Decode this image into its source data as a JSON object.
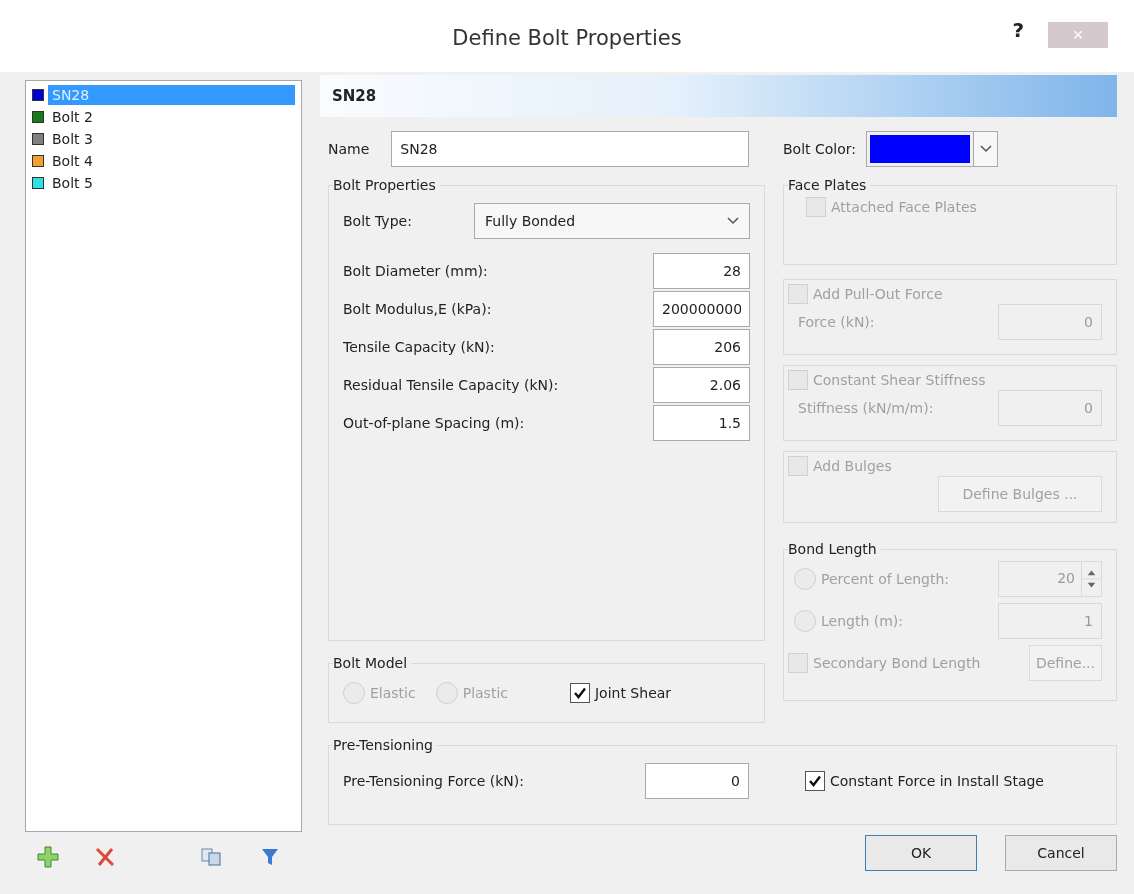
{
  "window": {
    "title": "Define Bolt Properties",
    "help": "?",
    "close": "×"
  },
  "bolt_list": [
    {
      "name": "SN28",
      "color": "#0000d0",
      "selected": true
    },
    {
      "name": "Bolt 2",
      "color": "#1a7a1a",
      "selected": false
    },
    {
      "name": "Bolt 3",
      "color": "#808080",
      "selected": false
    },
    {
      "name": "Bolt 4",
      "color": "#f0a030",
      "selected": false
    },
    {
      "name": "Bolt 5",
      "color": "#30e0e0",
      "selected": false
    }
  ],
  "header": "SN28",
  "name_field": {
    "label": "Name",
    "value": "SN28"
  },
  "bolt_color": {
    "label": "Bolt Color:",
    "color": "#0000ff"
  },
  "bolt_properties": {
    "title": "Bolt Properties",
    "type": {
      "label": "Bolt Type:",
      "value": "Fully Bonded"
    },
    "fields": [
      {
        "label": "Bolt Diameter (mm):",
        "value": "28"
      },
      {
        "label": "Bolt Modulus,E (kPa):",
        "value": "200000000"
      },
      {
        "label": "Tensile Capacity (kN):",
        "value": "206"
      },
      {
        "label": "Residual Tensile Capacity (kN):",
        "value": "2.06"
      },
      {
        "label": "Out-of-plane Spacing (m):",
        "value": "1.5"
      }
    ]
  },
  "bolt_model": {
    "title": "Bolt Model",
    "options": [
      {
        "kind": "radio",
        "label": "Elastic",
        "selected": false,
        "disabled": true
      },
      {
        "kind": "radio",
        "label": "Plastic",
        "selected": false,
        "disabled": true
      },
      {
        "kind": "checkbox",
        "label": "Joint Shear",
        "checked": true,
        "disabled": false
      }
    ]
  },
  "pre_tensioning": {
    "title": "Pre-Tensioning",
    "field": {
      "label": "Pre-Tensioning Force (kN):",
      "value": "0"
    },
    "constant": {
      "label": "Constant Force in Install Stage",
      "checked": true
    }
  },
  "face_plates": {
    "title": "Face Plates",
    "attached": {
      "label": "Attached Face Plates",
      "checked": false,
      "disabled": true
    }
  },
  "pull_out": {
    "label": "Add Pull-Out Force",
    "checked": false,
    "disabled": true,
    "field": {
      "label": "Force (kN):",
      "value": "0"
    }
  },
  "shear_stiffness": {
    "label": "Constant Shear Stiffness",
    "checked": false,
    "disabled": true,
    "field": {
      "label": "Stiffness (kN/m/m):",
      "value": "0"
    }
  },
  "bulges": {
    "label": "Add Bulges",
    "checked": false,
    "disabled": true,
    "button": "Define Bulges ..."
  },
  "bond_length": {
    "title": "Bond Length",
    "options": [
      {
        "kind": "spin",
        "label": "Percent of Length:",
        "selected": false,
        "disabled": true,
        "value": "20"
      },
      {
        "kind": "text",
        "label": "Length (m):",
        "selected": false,
        "disabled": true,
        "value": "1"
      }
    ],
    "secondary": {
      "label": "Secondary Bond Length",
      "checked": false,
      "disabled": true,
      "button": "Define..."
    }
  },
  "buttons": [
    {
      "label": "OK",
      "default": true
    },
    {
      "label": "Cancel",
      "default": false
    }
  ]
}
